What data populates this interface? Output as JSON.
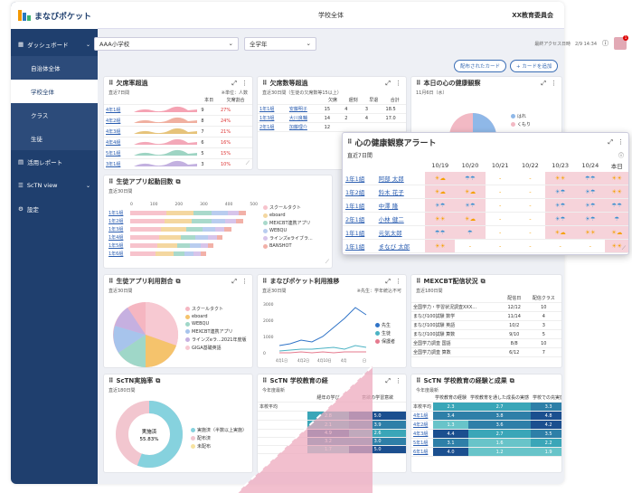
{
  "app": {
    "title": "まなびポケット",
    "page_title": "学校全体",
    "org": "XX教育委員会"
  },
  "sidebar": {
    "dashboard": "ダッシュボード",
    "items": [
      {
        "label": "自治体全体"
      },
      {
        "label": "学校全体"
      },
      {
        "label": "クラス"
      },
      {
        "label": "生徒"
      }
    ],
    "report": "活用レポート",
    "sctn": "ScTN view",
    "settings": "設定"
  },
  "filters": {
    "school": "AAA小学校",
    "grade": "全学年",
    "last_access": "最終アクセス日時　2/9 14:34",
    "notif_count": "1",
    "distributed_btn": "配布されたカード",
    "add_btn": "+ カードを追加"
  },
  "absence_rate": {
    "title": "欠席率超過",
    "period": "直近7日間",
    "unit": "※単位：人数",
    "col_today": "本日",
    "col_rate": "欠席割合",
    "rows": [
      {
        "cls": "4年1組",
        "n": "9",
        "rate": "27%"
      },
      {
        "cls": "4年2組",
        "n": "8",
        "rate": "24%"
      },
      {
        "cls": "4年3組",
        "n": "7",
        "rate": "21%"
      },
      {
        "cls": "4年4組",
        "n": "6",
        "rate": "16%"
      },
      {
        "cls": "5年1組",
        "n": "5",
        "rate": "15%"
      },
      {
        "cls": "3年1組",
        "n": "3",
        "rate": "10%"
      }
    ]
  },
  "absence_count": {
    "title": "欠席数等超過",
    "period": "直近30日間（生徒の欠席数等15以上）",
    "headers": [
      "欠席",
      "遅刻",
      "早退",
      "合計"
    ],
    "rows": [
      {
        "cls": "1年1組",
        "name": "安藤明子",
        "v": [
          "15",
          "4",
          "3",
          "18.5"
        ]
      },
      {
        "cls": "1年3組",
        "name": "大川良輔",
        "v": [
          "14",
          "2",
          "4",
          "17.0"
        ]
      },
      {
        "cls": "2年1組",
        "name": "加藤理介",
        "v": [
          "12",
          "",
          "",
          ""
        ]
      }
    ]
  },
  "health_today": {
    "title": "本日の心の健康観察",
    "date": "11月6日（水）",
    "legend": [
      "はれ",
      "くもり"
    ]
  },
  "health_alert": {
    "title": "心の健康観察アラート",
    "period": "直近7日間",
    "dates": [
      "10/19",
      "10/20",
      "10/21",
      "10/22",
      "10/23",
      "10/24",
      "本日"
    ],
    "rows": [
      {
        "cls": "1年1組",
        "name": "阿部 太郎",
        "cells": [
          "☀☁",
          "☂☂",
          "-",
          "-",
          "☀☀",
          "☂☂",
          "☀☀"
        ]
      },
      {
        "cls": "1年2組",
        "name": "鈴木 花子",
        "cells": [
          "☀☁",
          "☀☁",
          "-",
          "-",
          "☀☂",
          "☀☂",
          "☀☀"
        ]
      },
      {
        "cls": "1年1組",
        "name": "中澤 隆",
        "cells": [
          "☀☂",
          "☀☂",
          "-",
          "-",
          "☀☂",
          "☀☂",
          "☂☂"
        ]
      },
      {
        "cls": "2年1組",
        "name": "小林 健二",
        "cells": [
          "☀☀",
          "☀☁",
          "-",
          "-",
          "☀☂",
          "☀☂",
          "☂"
        ]
      },
      {
        "cls": "1年1組",
        "name": "元気太郎",
        "cells": [
          "☂☂",
          "☂",
          "-",
          "-",
          "☀☁",
          "☀☀",
          "☀☁"
        ]
      },
      {
        "cls": "1年1組",
        "name": "まなび 太郎",
        "cells": [
          "☀☀",
          "-",
          "-",
          "-",
          "-",
          "-",
          "☀☀"
        ]
      }
    ]
  },
  "app_launch": {
    "title": "生徒アプリ起動回数",
    "period": "直近30日間",
    "ticks": [
      "0",
      "100",
      "200",
      "300",
      "400",
      "500"
    ],
    "classes": [
      "1年1組",
      "1年2組",
      "1年3組",
      "1年4組",
      "1年5組",
      "1年6組"
    ],
    "legend": [
      "スクールタクト",
      "eboard",
      "MEXCBT連携アプリ",
      "WEBQU",
      "ラインズeライブラ...",
      "BANSHOT"
    ]
  },
  "app_usage": {
    "title": "生徒アプリ利用割合",
    "period": "直近30日間",
    "legend": [
      "スクールタクト",
      "eboard",
      "WEBQU",
      "MEXCBT連携アプリ",
      "ラインズeラ...2021年度版",
      "GIGA基礎英語"
    ]
  },
  "pocket_trend": {
    "title": "まなびポケット利用推移",
    "period": "直近30日間",
    "note": "※先生：学年統込不可",
    "yticks": [
      "3000",
      "2000",
      "1000",
      "0"
    ],
    "xticks": [
      "4月1日",
      "4月2日",
      "4月10日",
      "4月",
      "日"
    ],
    "legend": [
      "先生",
      "生徒",
      "保護者"
    ]
  },
  "mexcbt": {
    "title": "MEXCBT配信状況",
    "period": "直近180日間",
    "headers": [
      "配信日",
      "配信クラス"
    ],
    "rows": [
      {
        "name": "全国学力・学習状況調査XXX...",
        "d": "12/12",
        "c": "10"
      },
      {
        "name": "まなび100試験 数学",
        "d": "11/14",
        "c": "4"
      },
      {
        "name": "まなび100試験 英語",
        "d": "10/2",
        "c": "3"
      },
      {
        "name": "まなび100試験 算数",
        "d": "9/10",
        "c": "5"
      },
      {
        "name": "全国学力調査 国語",
        "d": "8/8",
        "c": "10"
      },
      {
        "name": "全国学力調査 算数",
        "d": "6/12",
        "c": "7"
      }
    ]
  },
  "sctn_rate": {
    "title": "ScTN実施率",
    "period": "直近180日間",
    "center_label": "実施済",
    "center_value": "55.83%",
    "legend": [
      "実施済（半数以上実施）",
      "配布済",
      "未配布"
    ]
  },
  "sctn_school": {
    "title": "ScTN 学校教育の経",
    "period": "今年度最新",
    "col1": "経年の学び",
    "col2": "意欲の学習意欲",
    "avg_label": "本校平均",
    "rows": [
      {
        "cls": "ひまわり支援",
        "a": "2.8",
        "b": "5.0"
      },
      {
        "cls": "3年以上...",
        "a": "2.1",
        "b": "3.9"
      },
      {
        "cls": "",
        "a": "4.9",
        "b": "2.6"
      },
      {
        "cls": "",
        "a": "3.2",
        "b": "3.0"
      },
      {
        "cls": "",
        "a": "1.7",
        "b": "5.0"
      }
    ]
  },
  "sctn_result": {
    "title": "ScTN 学校教育の経験と成果",
    "period": "今年度最新",
    "headers": [
      "学校教育の経験",
      "学校教育を通した成長の実感",
      "学校での充実感"
    ],
    "rows": [
      {
        "cls": "本校平均",
        "v": [
          "2.3",
          "2.7",
          "3.3"
        ]
      },
      {
        "cls": "4年1組",
        "v": [
          "3.4",
          "3.8",
          "4.8"
        ]
      },
      {
        "cls": "4年2組",
        "v": [
          "1.3",
          "3.6",
          "4.2"
        ]
      },
      {
        "cls": "4年3組",
        "v": [
          "4.4",
          "2.7",
          "3.5"
        ]
      },
      {
        "cls": "5年1組",
        "v": [
          "3.1",
          "1.6",
          "2.2"
        ]
      },
      {
        "cls": "6年1組",
        "v": [
          "4.0",
          "1.2",
          "1.9"
        ]
      }
    ]
  }
}
